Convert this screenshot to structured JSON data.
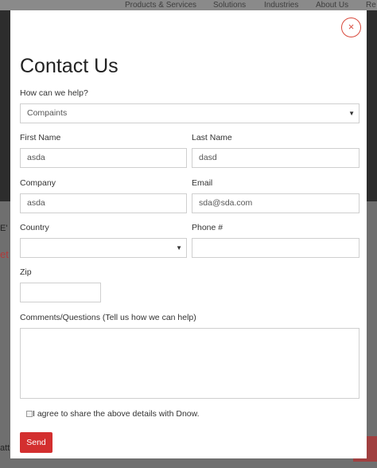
{
  "background": {
    "nav": [
      "Products & Services",
      "Solutions",
      "Industries",
      "About Us",
      "Re"
    ],
    "fragments": [
      "E'",
      "et",
      "att"
    ]
  },
  "modal": {
    "title": "Contact Us",
    "close_icon": "×",
    "help": {
      "label": "How can we help?",
      "value": "Compaints",
      "caret": "▼"
    },
    "first_name": {
      "label": "First Name",
      "value": "asda"
    },
    "last_name": {
      "label": "Last Name",
      "value": "dasd"
    },
    "company": {
      "label": "Company",
      "value": "asda"
    },
    "email": {
      "label": "Email",
      "value": "sda@sda.com"
    },
    "country": {
      "label": "Country",
      "value": "",
      "caret": "▼"
    },
    "phone": {
      "label": "Phone #",
      "value": ""
    },
    "zip": {
      "label": "Zip",
      "value": ""
    },
    "comments": {
      "label": "Comments/Questions (Tell us how we can help)",
      "value": ""
    },
    "agree": {
      "label": "I agree to share the above details with Dnow.",
      "checked": false
    },
    "send_label": "Send"
  },
  "colors": {
    "accent": "#d32f2f",
    "close": "#d94a3d"
  }
}
